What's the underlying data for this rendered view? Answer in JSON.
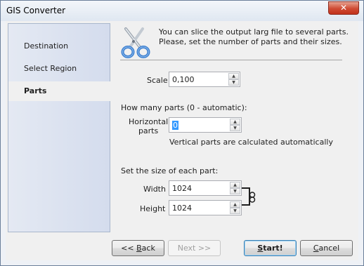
{
  "window": {
    "title": "GIS Converter",
    "close_glyph": "✕"
  },
  "sidebar": {
    "items": [
      {
        "label": "Destination",
        "active": false
      },
      {
        "label": "Select Region",
        "active": false
      },
      {
        "label": "Parts",
        "active": true
      }
    ]
  },
  "panel": {
    "intro_line1": "You can slice the output larg file to several parts.",
    "intro_line2": "Please, set the number of parts and their sizes.",
    "scale_label": "Scale",
    "scale_value": "0,100",
    "how_many_label": "How many parts (0 - automatic):",
    "horizontal_label_line1": "Horizontal",
    "horizontal_label_line2": "parts",
    "horizontal_value": "0",
    "vertical_note": "Vertical parts are calculated automatically",
    "size_label": "Set the size of each part:",
    "width_label": "Width",
    "width_value": "1024",
    "height_label": "Height",
    "height_value": "1024"
  },
  "buttons": {
    "back": {
      "prefix": "<< ",
      "mnemonic": "B",
      "rest": "ack"
    },
    "next": "Next >>",
    "start": {
      "mnemonic": "S",
      "rest": "tart!"
    },
    "cancel": {
      "mnemonic": "C",
      "rest": "ancel"
    }
  },
  "icons": {
    "scissors": "scissors-icon",
    "chain": "chain-link-icon",
    "close": "close-icon",
    "spin_up": "chevron-up-icon",
    "spin_down": "chevron-down-icon"
  },
  "colors": {
    "sidebar_bg": "#d8dfee",
    "selection": "#3399ff",
    "close_button": "#cf4b33",
    "scissors_handle": "#3d7fcf"
  }
}
